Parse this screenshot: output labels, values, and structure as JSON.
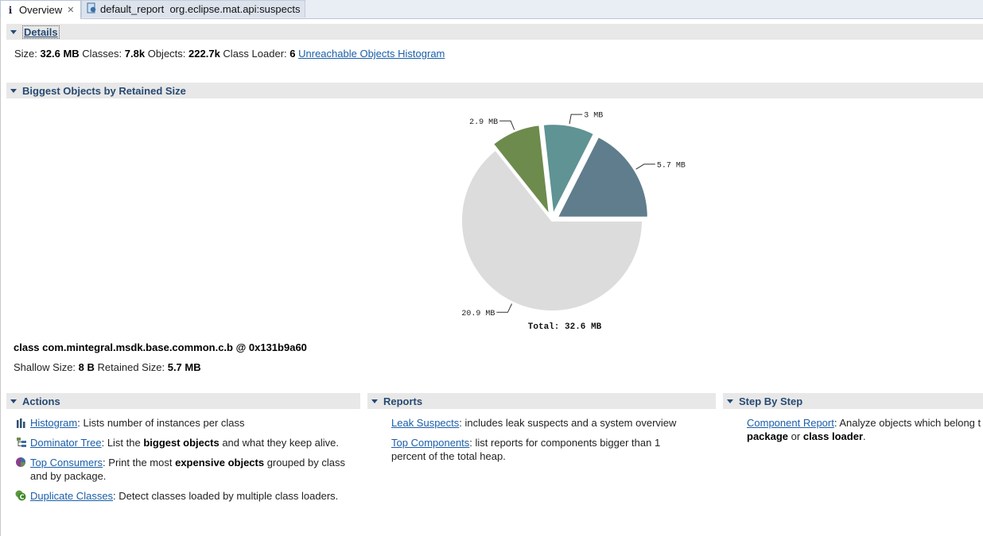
{
  "tabs": [
    {
      "label": "Overview",
      "icon": "info-icon",
      "close": "✕"
    },
    {
      "label": "default_report  org.eclipse.mat.api:suspects",
      "icon": "report-icon"
    }
  ],
  "details": {
    "title": "Details",
    "size_label": "Size:",
    "size_value": "32.6 MB",
    "classes_label": "Classes:",
    "classes_value": "7.8k",
    "objects_label": "Objects:",
    "objects_value": "222.7k",
    "loader_label": "Class Loader:",
    "loader_value": "6",
    "unreachable_link": "Unreachable Objects Histogram"
  },
  "biggest": {
    "title": "Biggest Objects by Retained Size"
  },
  "chart_data": {
    "type": "pie",
    "unit": "MB",
    "slices": [
      {
        "label": "5.7 MB",
        "value": 5.7,
        "color": "#5f7d8c"
      },
      {
        "label": "3 MB",
        "value": 3.0,
        "color": "#5f9394"
      },
      {
        "label": "2.9 MB",
        "value": 2.9,
        "color": "#6d8b4d"
      },
      {
        "label": "20.9 MB",
        "value": 20.9,
        "color": "#dcdcdc"
      }
    ],
    "total_label": "Total: 32.6 MB"
  },
  "selected_object": {
    "name": "class com.mintegral.msdk.base.common.c.b @ 0x131b9a60",
    "shallow_label": "Shallow Size:",
    "shallow_value": "8 B",
    "retained_label": "Retained Size:",
    "retained_value": "5.7 MB"
  },
  "actions": {
    "title": "Actions",
    "histogram_link": "Histogram",
    "histogram_text": ": Lists number of instances per class",
    "dominator_link": "Dominator Tree",
    "dominator_text_1": ": List the ",
    "dominator_bold": "biggest objects",
    "dominator_text_2": " and what they keep alive.",
    "consumers_link": "Top Consumers",
    "consumers_text_1": ": Print the most ",
    "consumers_bold": "expensive objects",
    "consumers_text_2": " grouped by class",
    "consumers_text_3": "and by package.",
    "duplicate_link": "Duplicate Classes",
    "duplicate_text": ": Detect classes loaded by multiple class loaders."
  },
  "reports": {
    "title": "Reports",
    "leak_link": "Leak Suspects",
    "leak_text": ": includes leak suspects and a system overview",
    "top_link": "Top Components",
    "top_text_1": ": list reports for components bigger than 1",
    "top_text_2": "percent of the total heap."
  },
  "steps": {
    "title": "Step By Step",
    "component_link": "Component Report",
    "component_text": ": Analyze objects which belong t",
    "package_bold": "package",
    "or_text": " or ",
    "loader_bold": "class loader",
    "period": "."
  }
}
